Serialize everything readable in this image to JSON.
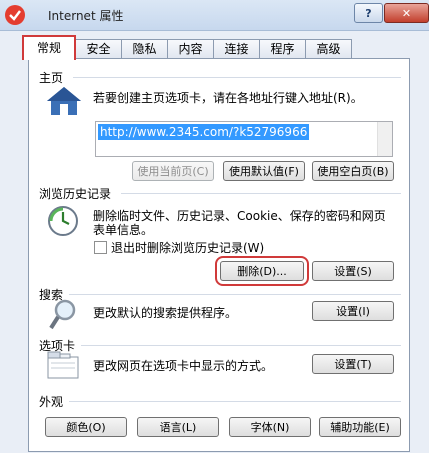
{
  "window": {
    "title": "Internet 属性",
    "help_label": "?",
    "close_label": "✕"
  },
  "tabs": [
    {
      "label": "常规"
    },
    {
      "label": "安全"
    },
    {
      "label": "隐私"
    },
    {
      "label": "内容"
    },
    {
      "label": "连接"
    },
    {
      "label": "程序"
    },
    {
      "label": "高级"
    }
  ],
  "home": {
    "section": "主页",
    "hint": "若要创建主页选项卡，请在各地址行键入地址(R)。",
    "url": "http://www.2345.com/?k52796966",
    "use_current": "使用当前页(C)",
    "use_default": "使用默认值(F)",
    "use_blank": "使用空白页(B)"
  },
  "history": {
    "section": "浏览历史记录",
    "desc_line1": "删除临时文件、历史记录、Cookie、保存的密码和网页",
    "desc_line2": "表单信息。",
    "exit_delete": "退出时删除浏览历史记录(W)",
    "delete": "删除(D)...",
    "settings": "设置(S)"
  },
  "search": {
    "section": "搜索",
    "desc": "更改默认的搜索提供程序。",
    "settings": "设置(I)"
  },
  "tabs_section": {
    "section": "选项卡",
    "desc": "更改网页在选项卡中显示的方式。",
    "settings": "设置(T)"
  },
  "appearance": {
    "section": "外观",
    "colors": "颜色(O)",
    "languages": "语言(L)",
    "fonts": "字体(N)",
    "accessibility": "辅助功能(E)"
  },
  "colors": {
    "highlight": "#d03a3a",
    "selection": "#3399ff"
  }
}
